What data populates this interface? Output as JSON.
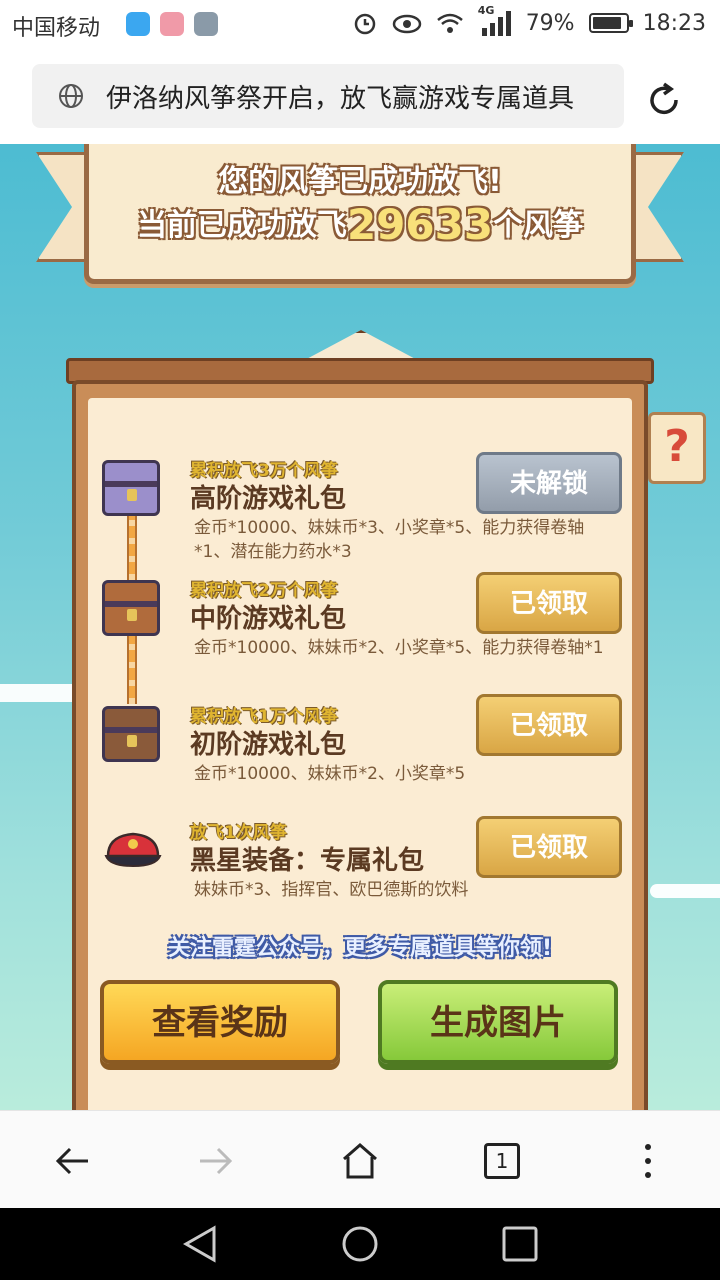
{
  "status_bar": {
    "carrier": "中国移动",
    "network": "4G",
    "battery": "79%",
    "time": "18:23"
  },
  "browser": {
    "url_text": "伊洛纳风筝祭开启，放飞赢游戏专属道具",
    "tab_count": "1"
  },
  "banner": {
    "line1": "您的风筝已成功放飞!",
    "line2_prefix": "当前已成功放飞",
    "count": "29633",
    "line2_suffix": "个风筝"
  },
  "help_label": "?",
  "rewards": [
    {
      "condition": "累积放飞3万个风筝",
      "title": "高阶游戏礼包",
      "desc": "金币*10000、妹妹币*3、小奖章*5、能力获得卷轴*1、潜在能力药水*3",
      "button": "未解锁",
      "status": "locked"
    },
    {
      "condition": "累积放飞2万个风筝",
      "title": "中阶游戏礼包",
      "desc": "金币*10000、妹妹币*2、小奖章*5、能力获得卷轴*1",
      "button": "已领取",
      "status": "claimed"
    },
    {
      "condition": "累积放飞1万个风筝",
      "title": "初阶游戏礼包",
      "desc": "金币*10000、妹妹币*2、小奖章*5",
      "button": "已领取",
      "status": "claimed"
    },
    {
      "condition": "放飞1次风筝",
      "title": "黑星装备：专属礼包",
      "desc": "妹妹币*3、指挥官、欧巴德斯的饮料",
      "button": "已领取",
      "status": "claimed"
    }
  ],
  "follow_text": "关注雷霆公众号，更多专属道具等你领!",
  "actions": {
    "view_rewards": "查看奖励",
    "generate_image": "生成图片"
  },
  "colors": {
    "sky": "#4dbcd2",
    "board": "#fbecd3",
    "locked_button": "#a6b0bd",
    "claimed_button": "#e6bb5b",
    "view_button": "#ffc43d",
    "generate_button": "#a8dc58"
  }
}
